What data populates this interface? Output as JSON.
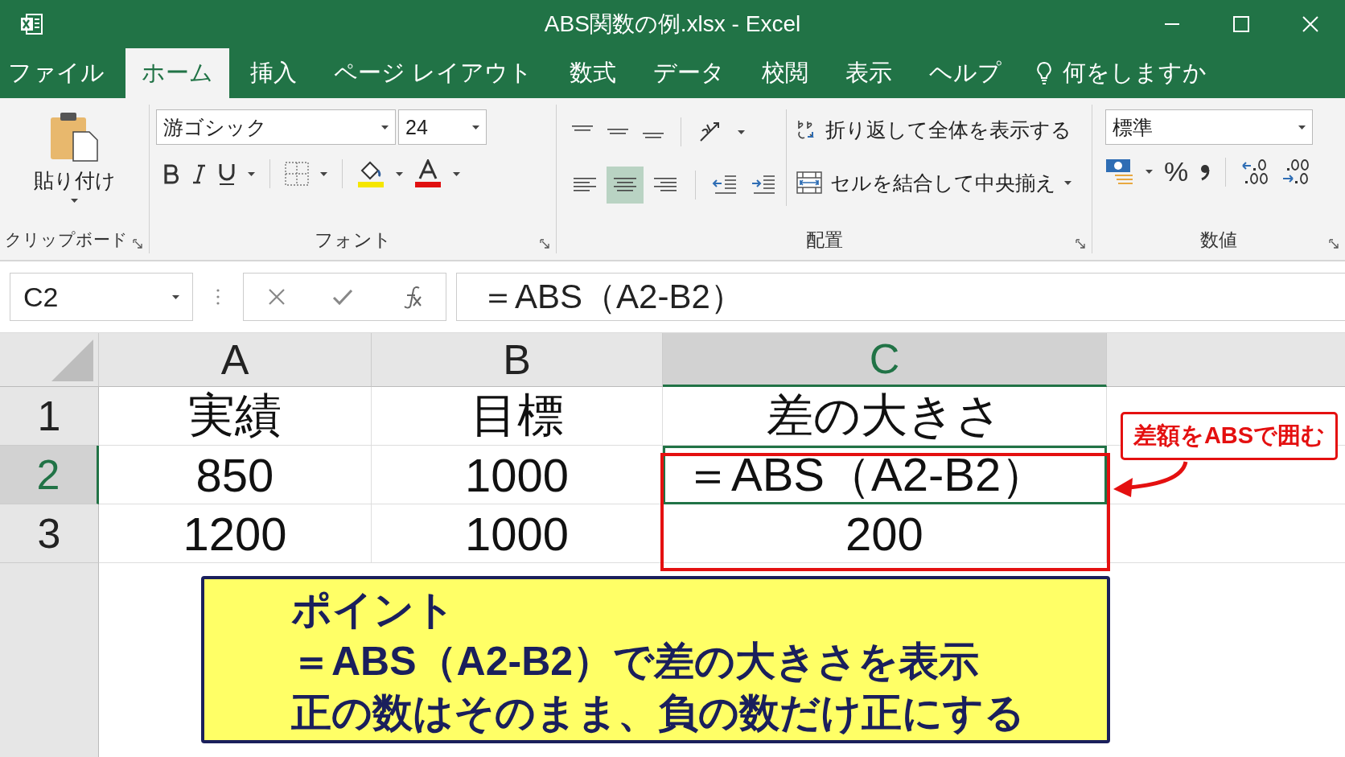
{
  "window": {
    "title": "ABS関数の例.xlsx - Excel"
  },
  "tabs": [
    {
      "label": "ファイル",
      "selected": false
    },
    {
      "label": "ホーム",
      "selected": true
    },
    {
      "label": "挿入",
      "selected": false
    },
    {
      "label": "ページ レイアウト",
      "selected": false
    },
    {
      "label": "数式",
      "selected": false
    },
    {
      "label": "データ",
      "selected": false
    },
    {
      "label": "校閲",
      "selected": false
    },
    {
      "label": "表示",
      "selected": false
    },
    {
      "label": "ヘルプ",
      "selected": false
    }
  ],
  "tell_me": {
    "label": "何をしますか"
  },
  "clipboard": {
    "paste_label": "貼り付け",
    "group_label": "クリップボード"
  },
  "font": {
    "font_name": "游ゴシック",
    "font_size": "24",
    "group_label": "フォント"
  },
  "alignment": {
    "align_buttons": [
      {
        "kind": "left",
        "selected": false
      },
      {
        "kind": "center",
        "selected": true
      },
      {
        "kind": "right",
        "selected": false
      }
    ],
    "wrap_text": "折り返して全体を表示する",
    "merge_center": "セルを結合して中央揃え",
    "group_label": "配置"
  },
  "number": {
    "format": "標準",
    "percent": "%",
    "group_label": "数値"
  },
  "formula_bar": {
    "name_box": "C2",
    "formula": "＝ABS（A2-B2）"
  },
  "sheet": {
    "columns": [
      {
        "label": "A",
        "selected": false
      },
      {
        "label": "B",
        "selected": false
      },
      {
        "label": "C",
        "selected": true
      }
    ],
    "rows": [
      {
        "header": "1",
        "selected": false,
        "cells": [
          "実績",
          "目標",
          "差の大きさ"
        ]
      },
      {
        "header": "2",
        "selected": true,
        "cells": [
          "850",
          "1000",
          "＝ABS（A2-B2）"
        ]
      },
      {
        "header": "3",
        "selected": false,
        "cells": [
          "1200",
          "1000",
          "200"
        ]
      }
    ]
  },
  "callout": {
    "text": "差額をABSで囲む"
  },
  "note": {
    "lines": [
      "ポイント",
      "＝ABS（A2-B2）で差の大きさを表示",
      "正の数はそのまま、負の数だけ正にする"
    ]
  }
}
